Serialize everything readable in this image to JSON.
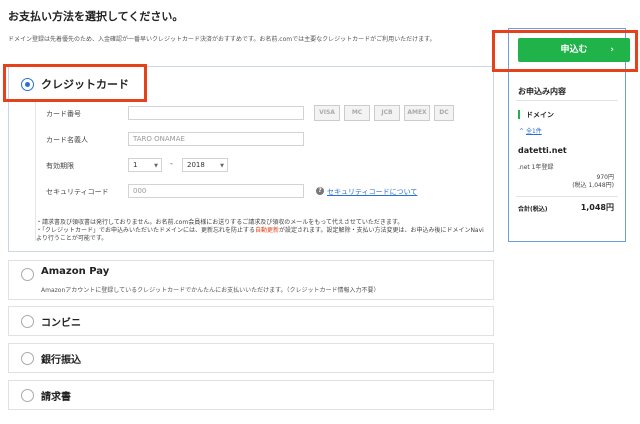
{
  "header": {
    "title": "お支払い方法を選択してください。",
    "description": "ドメイン登録は先着優先のため、入金確認が一番早いクレジットカード決済がおすすめです。お名前.comでは主要なクレジットカードがご利用いただけます。"
  },
  "credit_card": {
    "title": "クレジットカード",
    "card_number_label": "カード番号",
    "card_number_value": "",
    "card_name_label": "カード名義人",
    "card_name_placeholder": "TARO ONAMAE",
    "expiry_label": "有効期限",
    "expiry_month": "1",
    "expiry_separator": "-",
    "expiry_year": "2018",
    "security_label": "セキュリティコード",
    "security_placeholder": "000",
    "security_help": "セキュリティコードについて",
    "card_brands": [
      "VISA",
      "MC",
      "JCB",
      "AMEX",
      "DC"
    ],
    "notes": [
      "請求書及び領収書は発行しておりません。お名前.com会員様にお送りするご請求及び領収のメールをもって代えさせていただきます。",
      "「クレジットカード」でお申込みいただいたドメインには、更新忘れを防止する",
      "自動更新",
      "が設定されます。設定解除・支払い方法変更は、お申込み後にドメインNaviより行うことが可能です。"
    ]
  },
  "options": [
    {
      "title": "Amazon Pay",
      "desc": "Amazonアカウントに登録しているクレジットカードでかんたんにお支払いいただけます。（クレジットカード情報入力不要）"
    },
    {
      "title": "コンビニ",
      "desc": ""
    },
    {
      "title": "銀行振込",
      "desc": ""
    },
    {
      "title": "請求書",
      "desc": ""
    }
  ],
  "sidebar": {
    "apply_button": "申込む",
    "summary_title": "お申込み内容",
    "domain_section": "ドメイン",
    "toggle": "全1件",
    "domain_name": "datetti.net",
    "item_desc": ".net 1年登録",
    "price": "970円",
    "price_tax": "(税込 1,048円)",
    "total_label": "合計(税込)",
    "total_value": "1,048円"
  },
  "colors": {
    "accent": "#2a6fd6",
    "apply_green": "#1fb34a",
    "highlight_red": "#e5421c",
    "sidebar_border": "#6e9fd9"
  }
}
